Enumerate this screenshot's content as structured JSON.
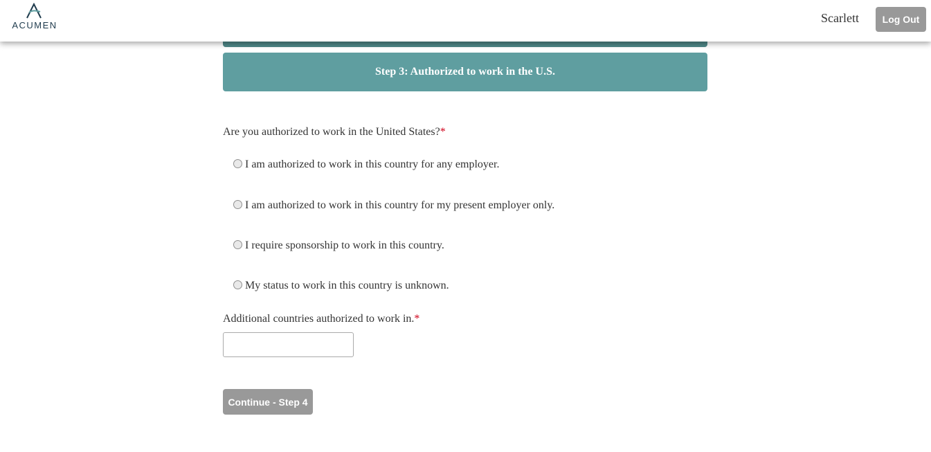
{
  "header": {
    "logo_text": "ACUMEN",
    "username": "Scarlett",
    "logout_label": "Log Out"
  },
  "step": {
    "title": "Step 3: Authorized to work in the U.S."
  },
  "form": {
    "question": "Are you authorized to work in the United States?",
    "required_mark": "*",
    "options": [
      {
        "label": "I am authorized to work in this country for any employer.",
        "selected": false
      },
      {
        "label": "I am authorized to work in this country for my present employer only.",
        "selected": false
      },
      {
        "label": "I require sponsorship to work in this country.",
        "selected": false
      },
      {
        "label": "My status to work in this country is unknown.",
        "selected": false
      }
    ],
    "countries_label": "Additional countries authorized to work in.",
    "countries_value": "",
    "continue_label": "Continue - Step 4"
  },
  "colors": {
    "accent": "#5f9ea0",
    "button_gray": "#999999",
    "required": "#d0021b"
  }
}
